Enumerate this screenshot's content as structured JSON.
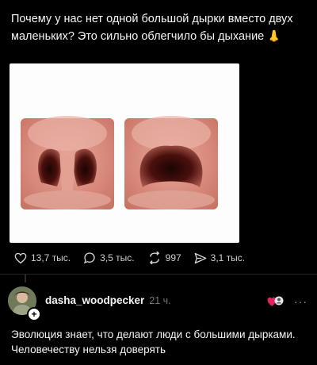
{
  "post": {
    "text": "Почему у нас нет одной большой дырки вместо двух маленьких? Это сильно облегчило бы дыхание",
    "emoji": "👃"
  },
  "image": {
    "background": "#fdfdfd",
    "skin": "#d9897c"
  },
  "actions": {
    "likes": "13,7 тыс.",
    "replies": "3,5 тыс.",
    "reposts": "997",
    "shares": "3,1 тыс."
  },
  "reply": {
    "username": "dasha_woodpecker",
    "time": "21 ч.",
    "text": "Эволюция знает, что делают люди с большими дырками. Человечеству нельзя доверять",
    "more": "···"
  },
  "colors": {
    "background": "#000000",
    "text": "#f3f3f3",
    "muted": "#777777",
    "heart": "#e0245e"
  },
  "icons": [
    "heart-icon",
    "comment-icon",
    "repost-icon",
    "share-icon",
    "plus-icon",
    "more-icon"
  ]
}
